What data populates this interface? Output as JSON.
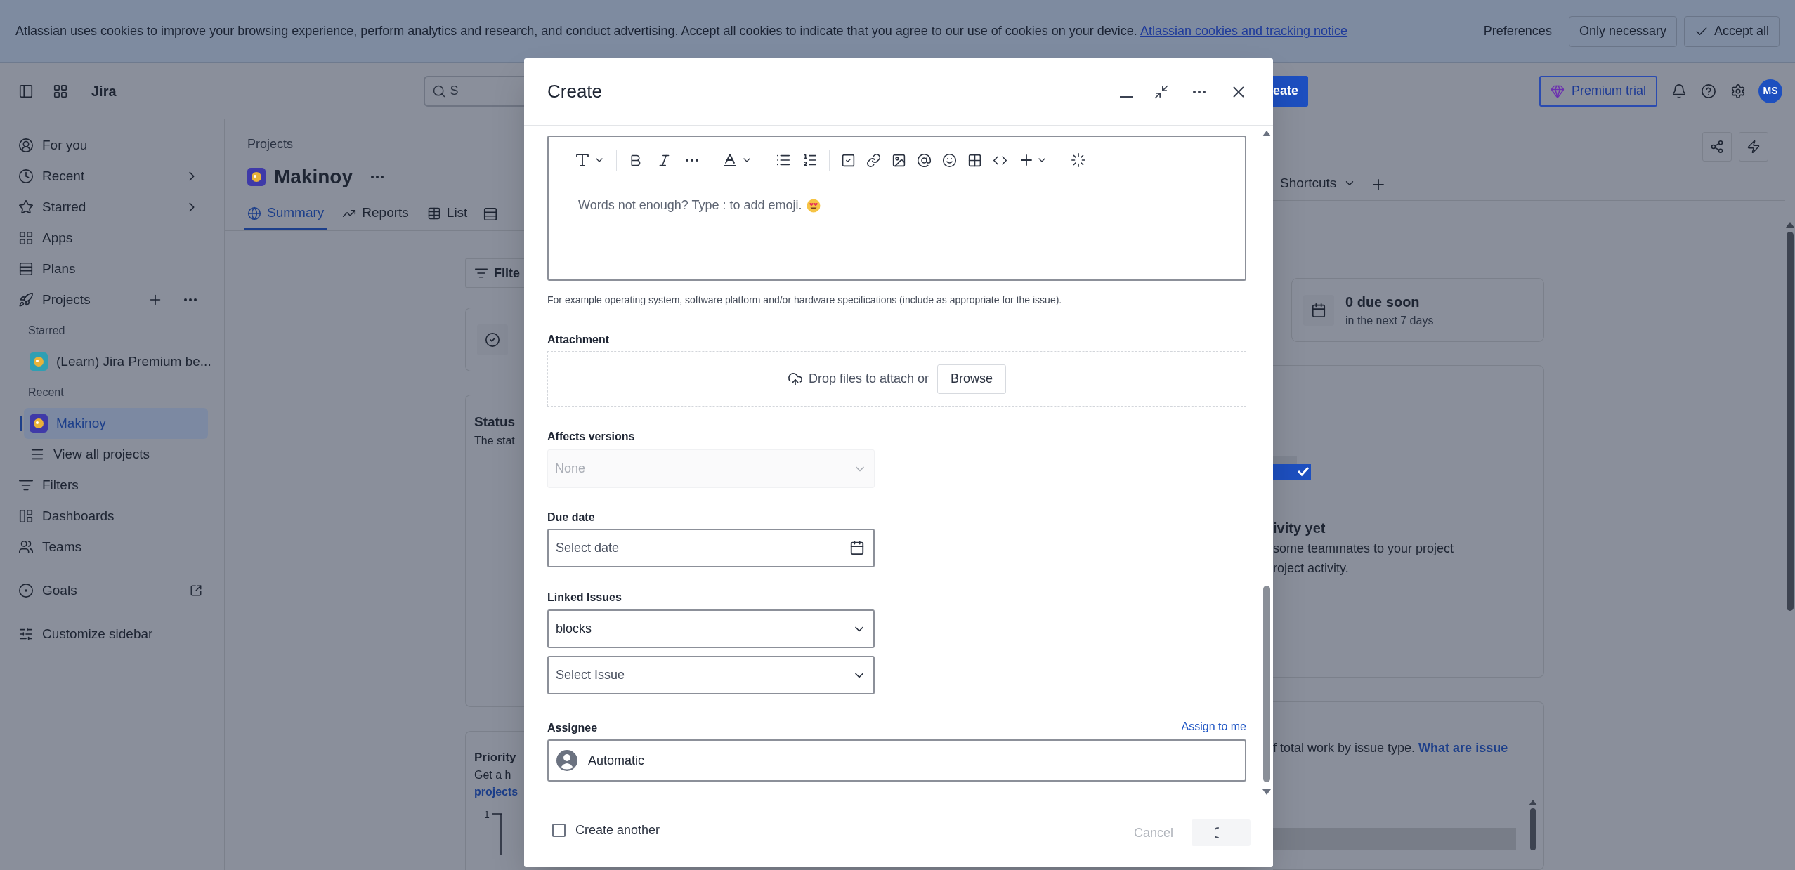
{
  "cookie_banner": {
    "message": "Atlassian uses cookies to improve your browsing experience, perform analytics and research, and conduct advertising. Accept all cookies to indicate that you agree to our use of cookies on your device.",
    "link": "Atlassian cookies and tracking notice",
    "buttons": [
      {
        "label": "Preferences",
        "kind": "text"
      },
      {
        "label": "Only necessary",
        "kind": "outline"
      },
      {
        "label": "Accept all",
        "kind": "check"
      }
    ]
  },
  "header": {
    "product": "Jira",
    "search_placeholder": "S",
    "create_button": "eate",
    "premium_button": "Premium trial",
    "avatar": "MS"
  },
  "sidebar": {
    "items": [
      {
        "kind": "nav",
        "label": "For you",
        "selected": false
      },
      {
        "kind": "expand",
        "label": "Recent",
        "selected": false
      },
      {
        "kind": "expand",
        "label": "Starred",
        "selected": false
      },
      {
        "kind": "nav",
        "label": "Apps",
        "selected": false
      },
      {
        "kind": "nav",
        "label": "Plans",
        "selected": false
      },
      {
        "kind": "actions",
        "label": "Projects",
        "selected": false
      },
      {
        "kind": "section",
        "label": "Starred"
      },
      {
        "kind": "project",
        "label": "(Learn) Jira Premium be...",
        "color": "#2f9fb3",
        "selected": false
      },
      {
        "kind": "section",
        "label": "Recent"
      },
      {
        "kind": "project",
        "label": "Makinoy",
        "color": "#3f3aa8",
        "selected": true
      },
      {
        "kind": "sub",
        "label": "View all projects",
        "selected": false
      },
      {
        "kind": "nav",
        "label": "Filters",
        "selected": false
      },
      {
        "kind": "nav",
        "label": "Dashboards",
        "selected": false
      },
      {
        "kind": "nav",
        "label": "Teams",
        "selected": false
      },
      {
        "kind": "external",
        "label": "Goals",
        "selected": false
      },
      {
        "kind": "nav",
        "label": "Customize sidebar",
        "selected": false
      }
    ]
  },
  "project": {
    "breadcrumb": "Projects",
    "title": "Makinoy",
    "tabs": [
      {
        "label": "Summary",
        "selected": true
      },
      {
        "label": "Reports",
        "selected": false
      },
      {
        "label": "List",
        "selected": false
      }
    ],
    "more_tabs": [
      {
        "label": "Shortcuts",
        "selected": false
      }
    ]
  },
  "summary": {
    "filter_button": "Filte",
    "due_card": {
      "title": "0 due soon",
      "subtitle": "in the next 7 days"
    },
    "status_card": {
      "title": "Status",
      "description": "The stat"
    },
    "activity_card": {
      "title": "ivity yet",
      "lines": [
        "some teammates to your project",
        "roject activity."
      ]
    },
    "priority_card": {
      "title": "Priority",
      "lines": [
        "Get a h"
      ],
      "link": "projects",
      "axis_label": "1"
    },
    "types_card": {
      "text": "f total work by issue type.",
      "link": "What are issue"
    }
  },
  "dialog": {
    "title": "Create",
    "editor": {
      "placeholder": "Words not enough? Type : to add emoji."
    },
    "editor_help": "For example operating system, software platform and/or hardware specifications (include as appropriate for the issue).",
    "fields": [
      {
        "kind": "attachment",
        "label": "Attachment",
        "text": "Drop files to attach or",
        "button": "Browse"
      },
      {
        "kind": "select",
        "label": "Affects versions",
        "placeholder": "None",
        "disabled": true
      },
      {
        "kind": "date",
        "label": "Due date",
        "placeholder": "Select date"
      },
      {
        "kind": "linked",
        "label": "Linked Issues",
        "value": "blocks",
        "placeholder": "Select Issue"
      },
      {
        "kind": "user",
        "label": "Assignee",
        "action": "Assign to me",
        "value": "Automatic"
      }
    ],
    "footer": {
      "checkbox": {
        "label": "Create another",
        "checked": false
      },
      "cancel": {
        "label": "Cancel",
        "disabled": true
      },
      "submit": {
        "loading": true
      }
    }
  }
}
